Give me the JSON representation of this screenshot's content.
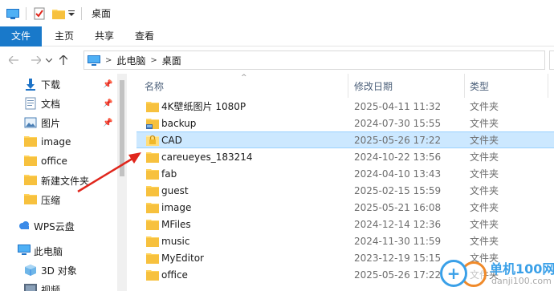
{
  "window": {
    "title": "桌面"
  },
  "ribbon": {
    "tabs": [
      "文件",
      "主页",
      "共享",
      "查看"
    ]
  },
  "address": {
    "crumbs": [
      "此电脑",
      "桌面"
    ]
  },
  "nav": {
    "items": [
      {
        "label": "下载",
        "icon": "download-icon",
        "pinned": true
      },
      {
        "label": "文档",
        "icon": "document-icon",
        "pinned": true
      },
      {
        "label": "图片",
        "icon": "picture-icon",
        "pinned": true
      },
      {
        "label": "image",
        "icon": "folder-icon",
        "pinned": false
      },
      {
        "label": "office",
        "icon": "folder-icon",
        "pinned": false
      },
      {
        "label": "新建文件夹",
        "icon": "folder-icon",
        "pinned": false
      },
      {
        "label": "压缩",
        "icon": "folder-icon",
        "pinned": false
      },
      {
        "label": "WPS云盘",
        "icon": "cloud-icon",
        "pinned": false
      },
      {
        "label": "此电脑",
        "icon": "computer-icon",
        "pinned": false
      },
      {
        "label": "3D 对象",
        "icon": "3d-objects-icon",
        "pinned": false
      },
      {
        "label": "视频",
        "icon": "video-icon",
        "pinned": false
      }
    ]
  },
  "list": {
    "columns": [
      "名称",
      "修改日期",
      "类型"
    ],
    "rows": [
      {
        "name": "4K壁纸图片 1080P",
        "date": "2025-04-11 11:32",
        "type": "文件夹",
        "icon": "folder-icon",
        "selected": false
      },
      {
        "name": "backup",
        "date": "2024-07-30 15:55",
        "type": "文件夹",
        "icon": "shared-folder-icon",
        "selected": false
      },
      {
        "name": "CAD",
        "date": "2025-05-26 17:22",
        "type": "文件夹",
        "icon": "locked-folder-icon",
        "selected": true
      },
      {
        "name": "careueyes_183214",
        "date": "2024-10-22 13:56",
        "type": "文件夹",
        "icon": "folder-icon",
        "selected": false
      },
      {
        "name": "fab",
        "date": "2024-04-10 13:43",
        "type": "文件夹",
        "icon": "folder-icon",
        "selected": false
      },
      {
        "name": "guest",
        "date": "2025-02-15 15:59",
        "type": "文件夹",
        "icon": "folder-icon",
        "selected": false
      },
      {
        "name": "image",
        "date": "2025-05-21 16:08",
        "type": "文件夹",
        "icon": "folder-icon",
        "selected": false
      },
      {
        "name": "MFiles",
        "date": "2024-12-14 12:36",
        "type": "文件夹",
        "icon": "folder-icon",
        "selected": false
      },
      {
        "name": "music",
        "date": "2024-11-30 11:59",
        "type": "文件夹",
        "icon": "folder-icon",
        "selected": false
      },
      {
        "name": "MyEditor",
        "date": "2023-12-19 15:15",
        "type": "文件夹",
        "icon": "folder-icon",
        "selected": false
      },
      {
        "name": "office",
        "date": "2025-05-26 17:22",
        "type": "文件夹",
        "icon": "folder-icon",
        "selected": false
      }
    ]
  },
  "watermark": {
    "text": "单机100网",
    "sub": "danji100.com"
  },
  "colors": {
    "accent": "#1979ca",
    "selection": "#cce8ff",
    "folder": "#ffd35c",
    "annotation_arrow": "#e0261c"
  }
}
